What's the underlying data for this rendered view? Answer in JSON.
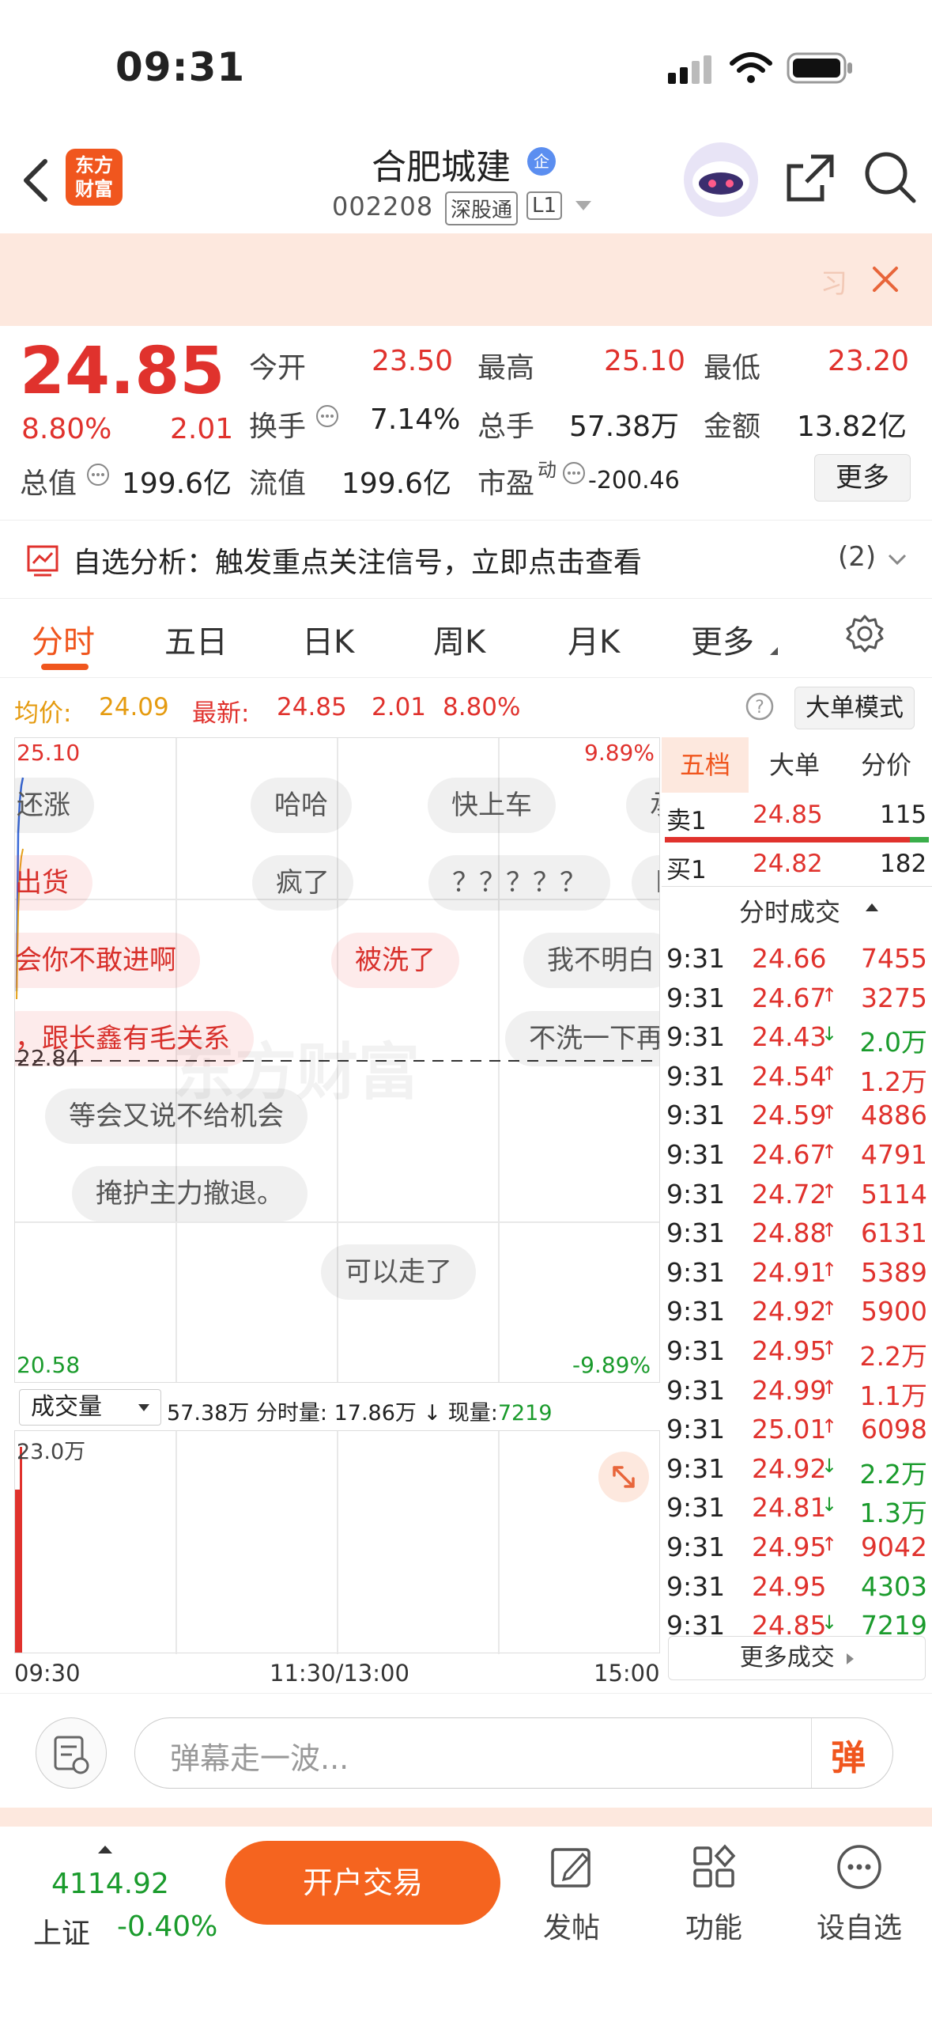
{
  "status": {
    "time": "09:31"
  },
  "header": {
    "logo_line1": "东方",
    "logo_line2": "财富",
    "stock_name": "合肥城建",
    "name_badge": "企",
    "stock_code": "002208",
    "tag1": "深股通",
    "tag2": "L1"
  },
  "banner": {
    "partial_text": "习"
  },
  "quote": {
    "price": "24.85",
    "change_pct": "8.80%",
    "change_amt": "2.01",
    "open_label": "今开",
    "open": "23.50",
    "high_label": "最高",
    "high": "25.10",
    "low_label": "最低",
    "low": "23.20",
    "turnover_label": "换手",
    "turnover": "7.14%",
    "volume_label": "总手",
    "volume": "57.38万",
    "amount_label": "金额",
    "amount": "13.82亿",
    "total_cap_label": "总值",
    "total_cap": "199.6亿",
    "float_cap_label": "流值",
    "float_cap": "199.6亿",
    "pe_label": "市盈",
    "pe_sup": "动",
    "pe": "-200.46",
    "more_button": "更多"
  },
  "analysis": {
    "text": "自选分析：触发重点关注信号，立即点击查看",
    "count": "(2)"
  },
  "tabs": [
    "分时",
    "五日",
    "日K",
    "周K",
    "月K",
    "更多"
  ],
  "infoline": {
    "avg_label": "均价:",
    "avg": "24.09",
    "latest_label": "最新:",
    "latest": "24.85",
    "latest_chg": "2.01",
    "latest_pct": "8.80%",
    "big_order_mode": "大单模式"
  },
  "chart": {
    "y_top": "25.10",
    "y_top_pct": "9.89%",
    "y_mid": "22.84",
    "y_bottom": "20.58",
    "y_bottom_pct": "-9.89%",
    "watermark": "东方财富"
  },
  "danmu": [
    {
      "text": "还涨",
      "style": "gray"
    },
    {
      "text": "哈哈",
      "style": "gray"
    },
    {
      "text": "快上车",
      "style": "gray"
    },
    {
      "text": "承",
      "style": "gray"
    },
    {
      "text": "出货",
      "style": "red"
    },
    {
      "text": "疯了",
      "style": "gray"
    },
    {
      "text": "？？？？？",
      "style": "gray"
    },
    {
      "text": "卧",
      "style": "gray"
    },
    {
      "text": "会你不敢进啊",
      "style": "red"
    },
    {
      "text": "被洗了",
      "style": "red"
    },
    {
      "text": "我不明白",
      "style": "gray"
    },
    {
      "text": "，跟长鑫有毛关系",
      "style": "red"
    },
    {
      "text": "不洗一下再",
      "style": "gray"
    },
    {
      "text": "等会又说不给机会",
      "style": "gray"
    },
    {
      "text": "掩护主力撤退。",
      "style": "gray"
    },
    {
      "text": "可以走了",
      "style": "gray"
    }
  ],
  "volume": {
    "selector": "成交量",
    "total": "57.38万",
    "tick_label": "分时量:",
    "tick_vol": "17.86万",
    "arrow": "↓",
    "now_label": "现量:",
    "now_vol": "7219",
    "y_max": "23.0万"
  },
  "time_axis": [
    "09:30",
    "11:30/13:00",
    "15:00"
  ],
  "orderbook": {
    "tabs": [
      "五档",
      "大单",
      "分价"
    ],
    "sell1_label": "卖1",
    "sell1_price": "24.85",
    "sell1_vol": "115",
    "buy1_label": "买1",
    "buy1_price": "24.82",
    "buy1_vol": "182",
    "ticks_title": "分时成交",
    "more_trades": "更多成交"
  },
  "trades": [
    {
      "t": "9:31",
      "p": "24.66",
      "arrow": "",
      "v": "7455",
      "vc": "red"
    },
    {
      "t": "9:31",
      "p": "24.67",
      "arrow": "↑",
      "v": "3275",
      "vc": "red"
    },
    {
      "t": "9:31",
      "p": "24.43",
      "arrow": "↓",
      "v": "2.0万",
      "vc": "green"
    },
    {
      "t": "9:31",
      "p": "24.54",
      "arrow": "↑",
      "v": "1.2万",
      "vc": "red"
    },
    {
      "t": "9:31",
      "p": "24.59",
      "arrow": "↑",
      "v": "4886",
      "vc": "red"
    },
    {
      "t": "9:31",
      "p": "24.67",
      "arrow": "↑",
      "v": "4791",
      "vc": "red"
    },
    {
      "t": "9:31",
      "p": "24.72",
      "arrow": "↑",
      "v": "5114",
      "vc": "red"
    },
    {
      "t": "9:31",
      "p": "24.88",
      "arrow": "↑",
      "v": "6131",
      "vc": "red"
    },
    {
      "t": "9:31",
      "p": "24.91",
      "arrow": "↑",
      "v": "5389",
      "vc": "red"
    },
    {
      "t": "9:31",
      "p": "24.92",
      "arrow": "↑",
      "v": "5900",
      "vc": "red"
    },
    {
      "t": "9:31",
      "p": "24.95",
      "arrow": "↑",
      "v": "2.2万",
      "vc": "red"
    },
    {
      "t": "9:31",
      "p": "24.99",
      "arrow": "↑",
      "v": "1.1万",
      "vc": "red"
    },
    {
      "t": "9:31",
      "p": "25.01",
      "arrow": "↑",
      "v": "6098",
      "vc": "red"
    },
    {
      "t": "9:31",
      "p": "24.92",
      "arrow": "↓",
      "v": "2.2万",
      "vc": "green"
    },
    {
      "t": "9:31",
      "p": "24.81",
      "arrow": "↓",
      "v": "1.3万",
      "vc": "green"
    },
    {
      "t": "9:31",
      "p": "24.95",
      "arrow": "↑",
      "v": "9042",
      "vc": "red"
    },
    {
      "t": "9:31",
      "p": "24.95",
      "arrow": "",
      "v": "4303",
      "vc": "green"
    },
    {
      "t": "9:31",
      "p": "24.85",
      "arrow": "↓",
      "v": "7219",
      "vc": "green"
    }
  ],
  "comment": {
    "placeholder": "弹幕走一波...",
    "danmu_button": "弹"
  },
  "bottom": {
    "index_value": "4114.92",
    "index_name": "上证",
    "index_pct": "-0.40%",
    "trade_button": "开户交易",
    "nav": [
      "发帖",
      "功能",
      "设自选"
    ]
  }
}
